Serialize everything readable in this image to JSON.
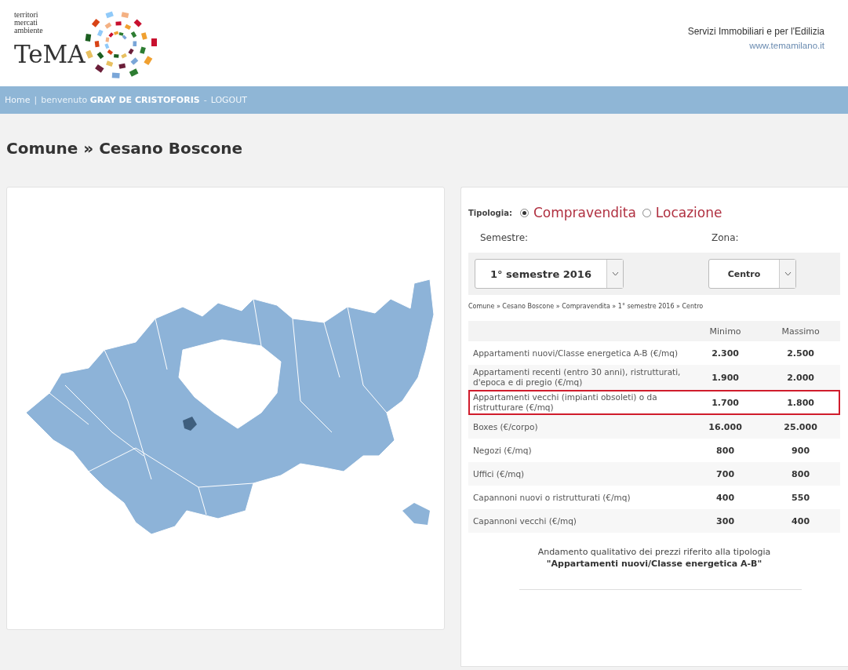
{
  "header": {
    "tagline": [
      "territori",
      "mercati",
      "ambiente"
    ],
    "brand": "TeMA",
    "service": "Servizi Immobiliari e per l'Edilizia",
    "website": "www.temamilano.it"
  },
  "nav": {
    "home": "Home",
    "separator": "|",
    "welcome": "benvenuto **GRAY DE CRISTOFORIS**",
    "dash": "-",
    "logout": "LOGOUT"
  },
  "page_title": "Comune » Cesano Boscone",
  "filters": {
    "tipologia_label": "Tipologia:",
    "tipologia_options": [
      {
        "label": "Compravendita",
        "selected": true
      },
      {
        "label": "Locazione",
        "selected": false
      }
    ],
    "semestre_label": "Semestre:",
    "semestre_value": "1° semestre 2016",
    "zona_label": "Zona:",
    "zona_value": "Centro"
  },
  "breadcrumb": "Comune » Cesano Boscone » Compravendita » 1° semestre 2016 » Centro",
  "table": {
    "columns": [
      "Minimo",
      "Massimo"
    ],
    "rows": [
      {
        "label": "Appartamenti nuovi/Classe energetica A-B (€/mq)",
        "min": "2.300",
        "max": "2.500",
        "highlighted": false
      },
      {
        "label": "Appartamenti recenti (entro 30 anni), ristrutturati, d'epoca e di pregio (€/mq)",
        "min": "1.900",
        "max": "2.000",
        "highlighted": false
      },
      {
        "label": "Appartamenti vecchi (impianti obsoleti) o da ristrutturare (€/mq)",
        "min": "1.700",
        "max": "1.800",
        "highlighted": true
      },
      {
        "label": "Boxes (€/corpo)",
        "min": "16.000",
        "max": "25.000",
        "highlighted": false
      },
      {
        "label": "Negozi (€/mq)",
        "min": "800",
        "max": "900",
        "highlighted": false
      },
      {
        "label": "Uffici (€/mq)",
        "min": "700",
        "max": "800",
        "highlighted": false
      },
      {
        "label": "Capannoni nuovi o ristrutturati (€/mq)",
        "min": "400",
        "max": "550",
        "highlighted": false
      },
      {
        "label": "Capannoni vecchi (€/mq)",
        "min": "300",
        "max": "400",
        "highlighted": false
      }
    ]
  },
  "trend_caption": "Andamento qualitativo dei prezzi riferito alla tipologia",
  "trend_type": "\"Appartamenti nuovi/Classe energetica A-B\""
}
